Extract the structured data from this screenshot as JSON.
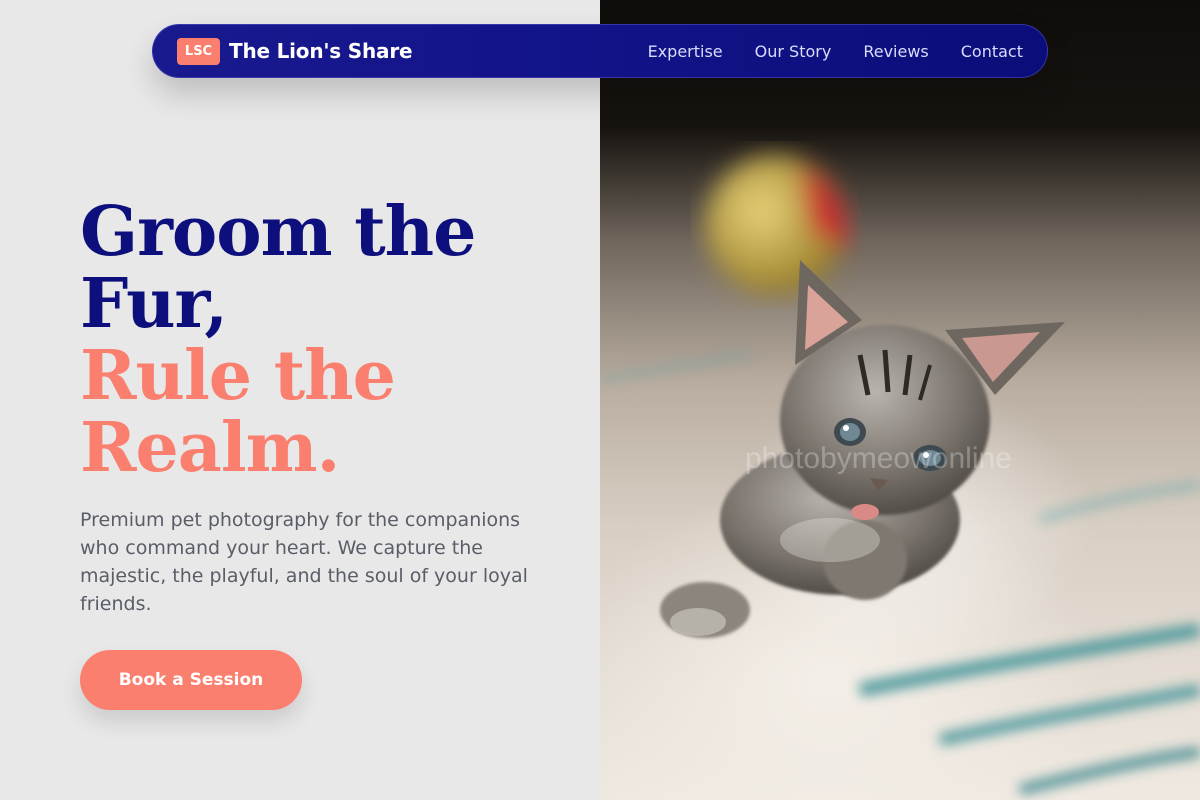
{
  "nav": {
    "logo_badge": "LSC",
    "brand_name": "The Lion's Share",
    "links": [
      "Expertise",
      "Our Story",
      "Reviews",
      "Contact"
    ]
  },
  "hero": {
    "headline_line1": "Groom the",
    "headline_line2": "Fur,",
    "headline_line3": "Rule the",
    "headline_line4": "Realm.",
    "description": "Premium pet photography for the companions who command your heart. We capture the majestic, the playful, and the soul of your loyal friends.",
    "cta_label": "Book a Session"
  },
  "photo": {
    "subject": "kitten-on-rug",
    "watermark": "photobymeowonline"
  },
  "colors": {
    "navy": "#0d0f7c",
    "coral": "#fa7f6e",
    "background": "#e8e8e8",
    "body_text": "#5a5d68"
  }
}
